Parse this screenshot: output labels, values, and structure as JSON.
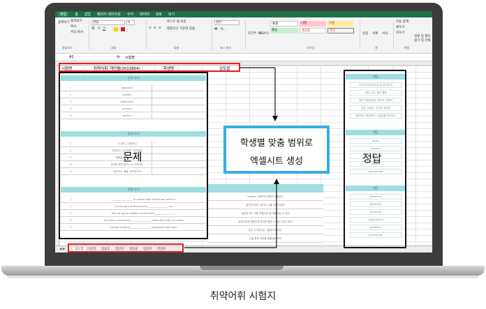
{
  "menubar": {
    "items": [
      "파일",
      "홈",
      "삽입",
      "페이지 레이아웃",
      "수식",
      "데이터",
      "검토",
      "보기"
    ]
  },
  "ribbon": {
    "clipboard": {
      "cut": "잘라내기",
      "copy": "복사",
      "paste": "붙여넣기",
      "format_painter": "서식 복사",
      "group": "클립보드"
    },
    "font": {
      "name": "굴림",
      "size": "9",
      "group": "글꼴"
    },
    "align": {
      "wrap": "텍스트 줄 바꿈",
      "merge": "병합하고 가운데 맞춤",
      "group": "맞춤"
    },
    "number": {
      "format": "일반",
      "group": "표시 형식"
    },
    "styles": {
      "conditional": "조건부 서식",
      "table": "표 서식",
      "normal": "표준",
      "bad": "나쁨",
      "neutral": "보통",
      "good": "좋음",
      "warn": "경고문",
      "calc": "계산",
      "group": "스타일"
    },
    "cells": {
      "insert": "삽입",
      "delete": "삭제",
      "format": "서식",
      "group": "셀"
    },
    "editing": {
      "autosum": "자동 합계",
      "fill": "채우기",
      "clear": "지우기",
      "sort": "정렬 및 필터",
      "find": "찾기 및 선택",
      "group": "편집"
    }
  },
  "formula": {
    "cell_ref": "A1",
    "fx": "fx",
    "value": "시험명"
  },
  "header_row": {
    "cells": [
      "시험명",
      "취약어휘_개인별(2022804)",
      "학생명",
      "김도엽"
    ]
  },
  "question_sheet": {
    "band1": "단어 쓰기",
    "band2": "단어 쓰기",
    "band3": "문장 쓰기",
    "words1": [
      "approach",
      "anxiety",
      "apparently",
      "primary",
      "confirm"
    ],
    "words2": [
      "순 쌍이 (그림자도)",
      "관련되다, (사건)에 ~하게되다",
      "영향을 받다, 좌우되다",
      "유지한 원칙 잡거나 쓴 가리키는",
      "부인하다, 불을 끄면 버리다"
    ],
    "sentences": [
      "_________________ to realize High School was difficult.",
      "The thought of being alone_________________ me.",
      "She can go on holiday all any other_________________.",
      "To make a reservation_________________ some with with us snacks.",
      "Instead of being_________________ accessible with them."
    ],
    "label": "문제"
  },
  "answer_sheet": {
    "band": "정답",
    "band2": "정답",
    "band3": "정답",
    "items1": [
      "다가가다(접근하다)(현 접근하다)",
      "걱정, 근심, 불안 불행",
      "겉보기에(분명히) 명백히, 분명히",
      "주된, 주요한, 초기의, 최초의",
      "확인하다, 확정하다, 사실임을 보여주다"
    ],
    "items2": [
      "tackle",
      "capture",
      "applied",
      "shifted",
      "guaranteed"
    ],
    "items3": [
      "[tr/forcus]",
      "[distilled]",
      "[exciting]",
      "[apprentice]",
      "[entitled]",
      "[confirmed]"
    ],
    "label": "정답"
  },
  "example_sheet": {
    "rows": [
      "Instant 고등학교 입학은 어렵었다",
      "생각만으로는 생각이 나를 두렵게 했다",
      "유효한 장소 어떤 보통으로 휴가를 떠날 수 있다",
      "일과시간에 원활하게 우리와 함께 스낵을 이야기 한다",
      "분석 주거보다는 그들과 어울리는",
      "건널 항목 처리할 예를 들어보자"
    ]
  },
  "callout": {
    "line1": "학생별 맞춤 범위로",
    "line2": "엑셀시트 생성"
  },
  "tabs": {
    "items": [
      "김도엽",
      "이동영",
      "장용호",
      "정인아",
      "정승원",
      "임승현",
      "한민준"
    ]
  },
  "caption": "취약어휘 시험지",
  "colors": {
    "excel_green": "#1e7145",
    "highlight_red": "#e02020",
    "callout_blue": "#3aace3",
    "band_teal": "#9fdede"
  }
}
